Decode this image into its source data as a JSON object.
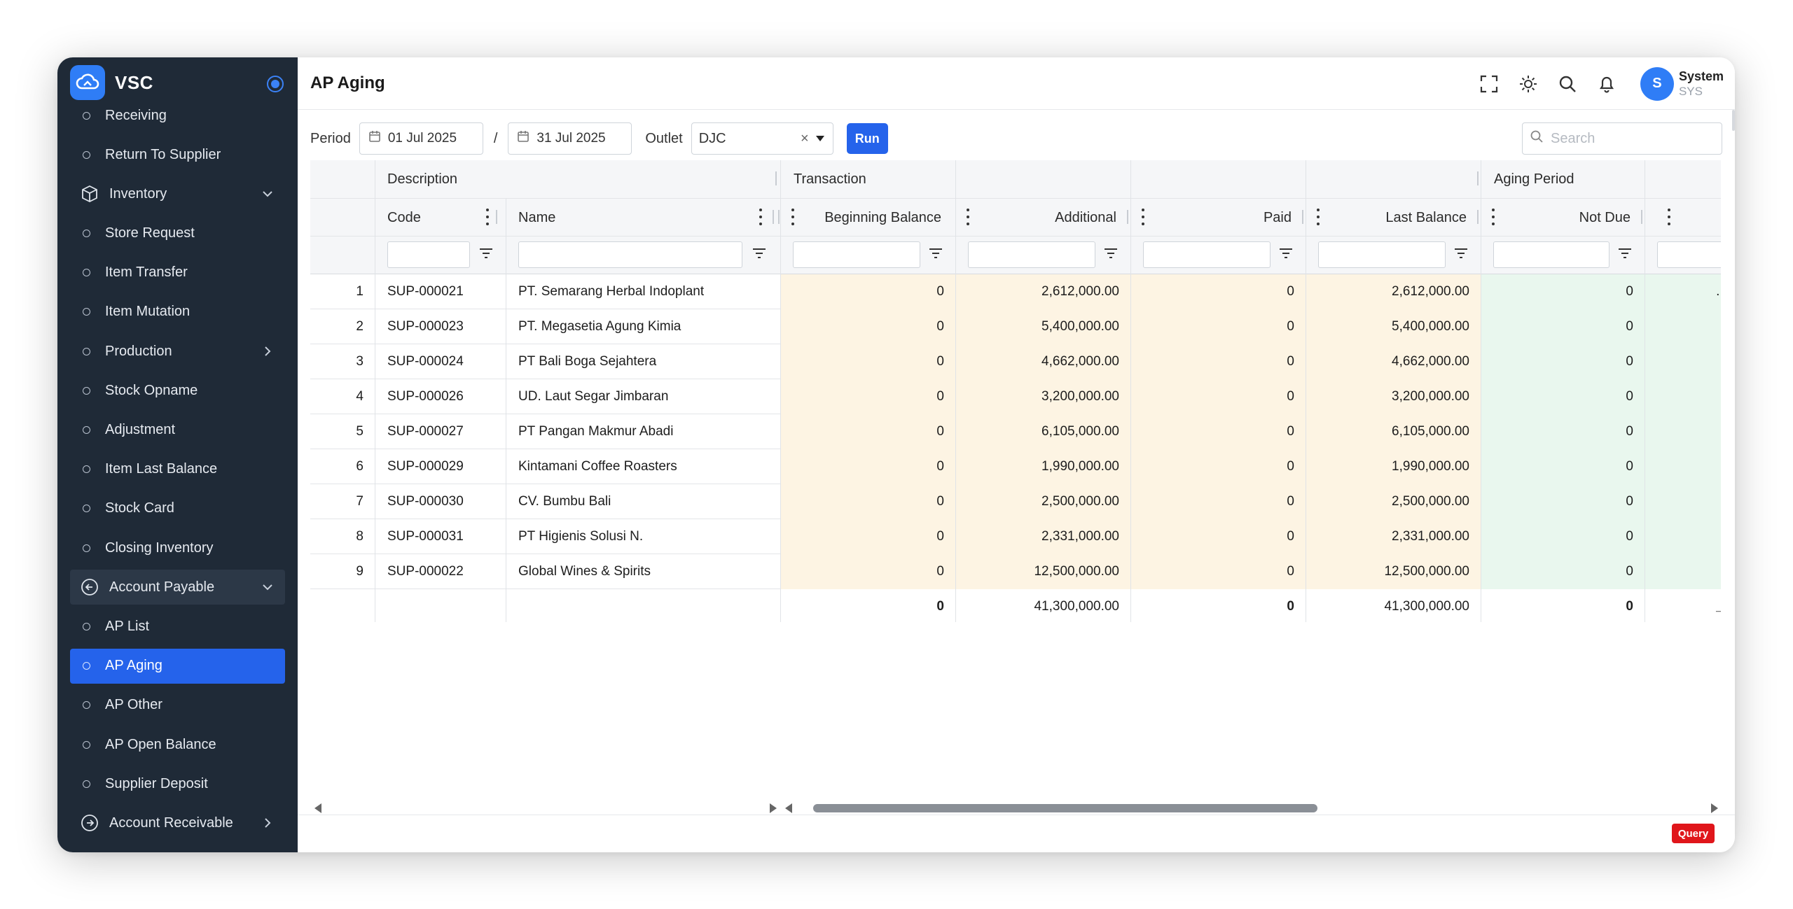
{
  "app": {
    "name": "VSC"
  },
  "sidebar": {
    "items": [
      {
        "label": "Receiving",
        "kind": "sub"
      },
      {
        "label": "Return To Supplier",
        "kind": "sub"
      },
      {
        "label": "Inventory",
        "kind": "group",
        "icon": "box-icon",
        "chevron": "down"
      },
      {
        "label": "Store Request",
        "kind": "sub"
      },
      {
        "label": "Item Transfer",
        "kind": "sub"
      },
      {
        "label": "Item Mutation",
        "kind": "sub"
      },
      {
        "label": "Production",
        "kind": "sub",
        "chevron": "right"
      },
      {
        "label": "Stock Opname",
        "kind": "sub"
      },
      {
        "label": "Adjustment",
        "kind": "sub"
      },
      {
        "label": "Item Last Balance",
        "kind": "sub"
      },
      {
        "label": "Stock Card",
        "kind": "sub"
      },
      {
        "label": "Closing Inventory",
        "kind": "sub"
      },
      {
        "label": "Account Payable",
        "kind": "group-open",
        "icon": "arrow-left-circle-icon",
        "chevron": "down"
      },
      {
        "label": "AP List",
        "kind": "sub"
      },
      {
        "label": "AP Aging",
        "kind": "active"
      },
      {
        "label": "AP Other",
        "kind": "sub"
      },
      {
        "label": "AP Open Balance",
        "kind": "sub"
      },
      {
        "label": "Supplier Deposit",
        "kind": "sub"
      },
      {
        "label": "Account Receivable",
        "kind": "group",
        "icon": "arrow-right-circle-icon",
        "chevron": "right"
      }
    ]
  },
  "header": {
    "title": "AP Aging",
    "user": {
      "initial": "S",
      "name": "System",
      "code": "SYS"
    },
    "icons": [
      "fullscreen-icon",
      "theme-sun-icon",
      "search-icon",
      "bell-icon"
    ]
  },
  "filters": {
    "period_label": "Period",
    "date_from": "01 Jul 2025",
    "date_sep": "/",
    "date_to": "31 Jul 2025",
    "outlet_label": "Outlet",
    "outlet_value": "DJC",
    "run_label": "Run",
    "search_placeholder": "Search"
  },
  "table": {
    "groups": {
      "description": "Description",
      "transaction": "Transaction",
      "aging": "Aging Period"
    },
    "columns": {
      "code": "Code",
      "name": "Name",
      "beginning": "Beginning Balance",
      "additional": "Additional",
      "paid": "Paid",
      "last": "Last Balance",
      "not_due": "Not Due"
    },
    "rows": [
      {
        "no": "1",
        "code": "SUP-000021",
        "name": "PT. Semarang Herbal Indoplant",
        "beginning": "0",
        "additional": "2,612,000.00",
        "paid": "0",
        "last": "2,612,000.00",
        "not_due": "0",
        "next": "..."
      },
      {
        "no": "2",
        "code": "SUP-000023",
        "name": "PT. Megasetia Agung Kimia",
        "beginning": "0",
        "additional": "5,400,000.00",
        "paid": "0",
        "last": "5,400,000.00",
        "not_due": "0",
        "next": ""
      },
      {
        "no": "3",
        "code": "SUP-000024",
        "name": "PT Bali Boga Sejahtera",
        "beginning": "0",
        "additional": "4,662,000.00",
        "paid": "0",
        "last": "4,662,000.00",
        "not_due": "0",
        "next": ""
      },
      {
        "no": "4",
        "code": "SUP-000026",
        "name": "UD. Laut Segar Jimbaran",
        "beginning": "0",
        "additional": "3,200,000.00",
        "paid": "0",
        "last": "3,200,000.00",
        "not_due": "0",
        "next": ""
      },
      {
        "no": "5",
        "code": "SUP-000027",
        "name": "PT Pangan Makmur Abadi",
        "beginning": "0",
        "additional": "6,105,000.00",
        "paid": "0",
        "last": "6,105,000.00",
        "not_due": "0",
        "next": ""
      },
      {
        "no": "6",
        "code": "SUP-000029",
        "name": "Kintamani Coffee Roasters",
        "beginning": "0",
        "additional": "1,990,000.00",
        "paid": "0",
        "last": "1,990,000.00",
        "not_due": "0",
        "next": ""
      },
      {
        "no": "7",
        "code": "SUP-000030",
        "name": "CV. Bumbu Bali",
        "beginning": "0",
        "additional": "2,500,000.00",
        "paid": "0",
        "last": "2,500,000.00",
        "not_due": "0",
        "next": ""
      },
      {
        "no": "8",
        "code": "SUP-000031",
        "name": "PT Higienis Solusi N.",
        "beginning": "0",
        "additional": "2,331,000.00",
        "paid": "0",
        "last": "2,331,000.00",
        "not_due": "0",
        "next": ""
      },
      {
        "no": "9",
        "code": "SUP-000022",
        "name": "Global Wines & Spirits",
        "beginning": "0",
        "additional": "12,500,000.00",
        "paid": "0",
        "last": "12,500,000.00",
        "not_due": "0",
        "next": ""
      }
    ],
    "totals": {
      "beginning": "0",
      "additional": "41,300,000.00",
      "paid": "0",
      "last": "41,300,000.00",
      "not_due": "0",
      "next": "_."
    }
  },
  "footer": {
    "query_label": "Query"
  },
  "colors": {
    "accent": "#2563eb",
    "sidebar_bg": "#1f2a37",
    "warm_cell": "#fdf4e3",
    "green_cell": "#e9f7ee",
    "query_red": "#e0161b"
  }
}
